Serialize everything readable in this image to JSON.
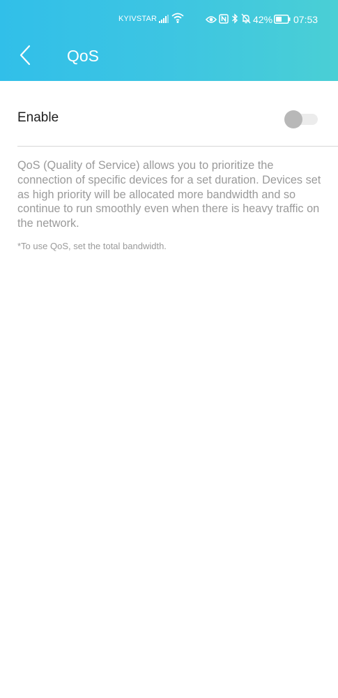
{
  "status_bar": {
    "carrier": "KYIVSTAR",
    "battery_percent": "42%",
    "time": "07:53",
    "icons": [
      "signal-icon",
      "wifi-icon",
      "eye-icon",
      "nfc-icon",
      "bluetooth-icon",
      "bell-off-icon",
      "battery-icon"
    ]
  },
  "header": {
    "title": "QoS",
    "gradient_colors": [
      "#31bfe9",
      "#4acfd5"
    ]
  },
  "settings": {
    "enable_label": "Enable",
    "enable_on": false
  },
  "content": {
    "description": "QoS (Quality of Service) allows you to prioritize the connection of specific devices for a set duration. Devices set as high priority will be allocated more bandwidth and so continue to run smoothly even when there is heavy traffic on the network.",
    "note": "*To use QoS, set the total bandwidth."
  }
}
